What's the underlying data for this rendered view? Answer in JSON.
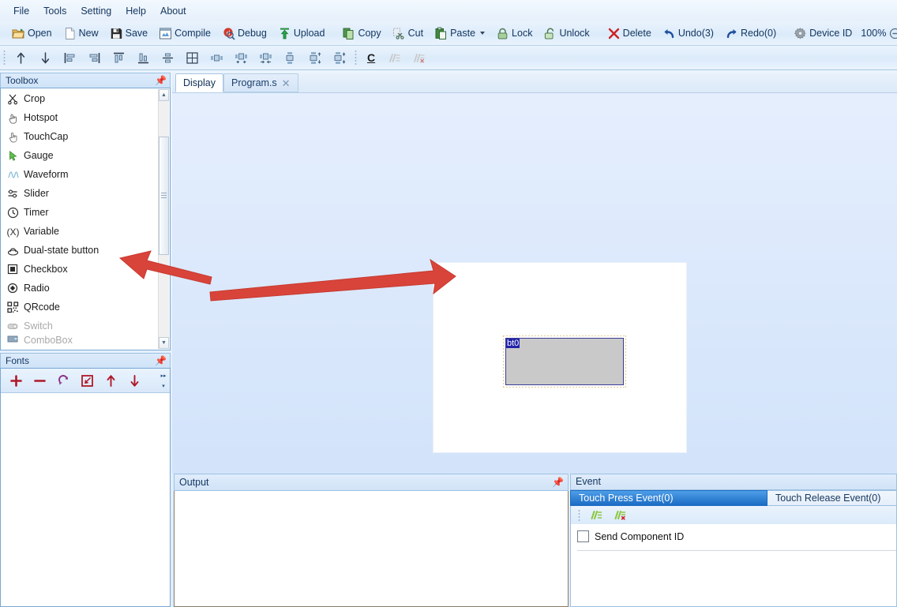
{
  "menubar": {
    "items": [
      {
        "label": "File"
      },
      {
        "label": "Tools"
      },
      {
        "label": "Setting"
      },
      {
        "label": "Help"
      },
      {
        "label": "About"
      }
    ]
  },
  "toolbar_main": {
    "groups": [
      {
        "buttons": [
          {
            "label": "Open",
            "icon": "open-folder-icon"
          },
          {
            "label": "New",
            "icon": "new-file-icon"
          },
          {
            "label": "Save",
            "icon": "save-floppy-icon"
          },
          {
            "label": "Compile",
            "icon": "compile-icon"
          },
          {
            "label": "Debug",
            "icon": "debug-icon"
          },
          {
            "label": "Upload",
            "icon": "upload-arrow-icon"
          }
        ]
      },
      {
        "buttons": [
          {
            "label": "Copy",
            "icon": "copy-icon"
          },
          {
            "label": "Cut",
            "icon": "cut-icon"
          },
          {
            "label": "Paste",
            "icon": "paste-icon",
            "has_dropdown": true
          },
          {
            "label": "Lock",
            "icon": "lock-closed-icon"
          },
          {
            "label": "Unlock",
            "icon": "lock-open-icon"
          }
        ]
      },
      {
        "buttons": [
          {
            "label": "Delete",
            "icon": "delete-x-icon"
          },
          {
            "label": "Undo(3)",
            "icon": "undo-icon"
          },
          {
            "label": "Redo(0)",
            "icon": "redo-icon"
          }
        ]
      },
      {
        "buttons": [
          {
            "label": "Device ID",
            "icon": "gear-icon"
          }
        ]
      }
    ],
    "zoom_level": "100%",
    "zoom_minus": "−"
  },
  "toolbar_align": {
    "buttons": [
      {
        "icon": "move-up-icon"
      },
      {
        "icon": "move-down-icon"
      },
      {
        "icon": "align-left-icon"
      },
      {
        "icon": "align-right-icon"
      },
      {
        "icon": "align-top-icon"
      },
      {
        "icon": "align-bottom-icon"
      },
      {
        "icon": "align-middle-icon"
      },
      {
        "icon": "center-both-icon"
      },
      {
        "icon": "same-width-icon"
      },
      {
        "icon": "distribute-h-left-icon"
      },
      {
        "icon": "distribute-h-right-icon"
      },
      {
        "icon": "same-height-icon"
      },
      {
        "icon": "distribute-v-top-icon"
      },
      {
        "icon": "distribute-v-bottom-icon"
      }
    ],
    "buttons2": [
      {
        "icon": "code-c-icon",
        "label": "C"
      },
      {
        "icon": "comment-add-icon"
      },
      {
        "icon": "comment-remove-icon"
      }
    ]
  },
  "toolbox": {
    "title": "Toolbox",
    "pin_icon": "pin-icon",
    "items": [
      {
        "label": "Crop",
        "icon": "scissors-icon",
        "disabled": false
      },
      {
        "label": "Hotspot",
        "icon": "hand-tap-icon",
        "disabled": false
      },
      {
        "label": "TouchCap",
        "icon": "hand-pointer-icon",
        "disabled": false
      },
      {
        "label": "Gauge",
        "icon": "cursor-arrow-icon",
        "disabled": false
      },
      {
        "label": "Waveform",
        "icon": "wave-icon",
        "disabled": false
      },
      {
        "label": "Slider",
        "icon": "slider-icon",
        "disabled": false
      },
      {
        "label": "Timer",
        "icon": "clock-icon",
        "disabled": false
      },
      {
        "label": "Variable",
        "icon": "variable-x-icon",
        "disabled": false
      },
      {
        "label": "Dual-state button",
        "icon": "dual-state-icon",
        "disabled": false
      },
      {
        "label": "Checkbox",
        "icon": "checkbox-icon",
        "disabled": false
      },
      {
        "label": "Radio",
        "icon": "radio-icon",
        "disabled": false
      },
      {
        "label": "QRcode",
        "icon": "qrcode-icon",
        "disabled": false
      },
      {
        "label": "Switch",
        "icon": "switch-icon",
        "disabled": true
      }
    ]
  },
  "fonts": {
    "title": "Fonts",
    "pin_icon": "pin-icon",
    "buttons": [
      {
        "icon": "plus-icon"
      },
      {
        "icon": "minus-icon"
      },
      {
        "icon": "refresh-icon"
      },
      {
        "icon": "edit-icon"
      },
      {
        "icon": "arrow-up-icon"
      },
      {
        "icon": "arrow-down-icon"
      }
    ]
  },
  "tabs": [
    {
      "label": "Display",
      "active": true,
      "closable": false
    },
    {
      "label": "Program.s",
      "active": false,
      "closable": true,
      "close_icon": "close-icon"
    }
  ],
  "canvas": {
    "component": {
      "id_label": "bt0"
    }
  },
  "output": {
    "title": "Output",
    "pin_icon": "pin-icon",
    "content": ""
  },
  "event": {
    "title": "Event",
    "tabs": [
      {
        "label": "Touch Press Event(0)",
        "active": true
      },
      {
        "label": "Touch Release Event(0)",
        "active": false
      }
    ],
    "toolbar": [
      {
        "icon": "comment-add-icon"
      },
      {
        "icon": "comment-remove-icon"
      }
    ],
    "checkbox": {
      "label": "Send Component ID",
      "checked": false
    }
  },
  "annotations": {
    "arrow_left": {
      "color": "#d9443a",
      "direction": "left"
    },
    "arrow_right": {
      "color": "#d9443a",
      "direction": "right"
    }
  },
  "colors": {
    "accent": "#1b6cc4",
    "panel_border": "#9dc1e2",
    "canvas_bg": "#dceafb",
    "annotation_red": "#d9443a",
    "selection_blue": "#2323a8"
  }
}
